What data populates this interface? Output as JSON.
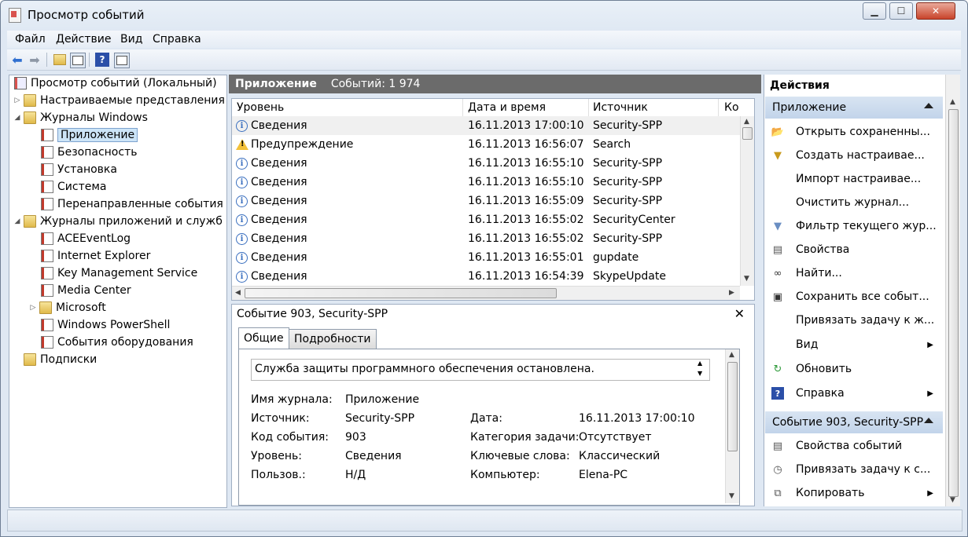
{
  "window": {
    "title": "Просмотр событий",
    "min_icon": "minimize-icon",
    "max_icon": "maximize-icon",
    "close_icon": "close-icon"
  },
  "menu": [
    "Файл",
    "Действие",
    "Вид",
    "Справка"
  ],
  "toolbar": [
    "back-arrow-icon",
    "forward-arrow-icon",
    "up-folder-icon",
    "show-hide-tree-icon",
    "help-icon",
    "show-hide-actions-icon"
  ],
  "tree": {
    "root": "Просмотр событий (Локальный)",
    "custom_views": "Настраиваемые представления",
    "windows_logs": "Журналы Windows",
    "windows_logs_items": [
      "Приложение",
      "Безопасность",
      "Установка",
      "Система",
      "Перенаправленные события"
    ],
    "app_services_logs": "Журналы приложений и служб",
    "app_services_items": [
      "ACEEventLog",
      "Internet Explorer",
      "Key Management Service",
      "Media Center",
      "Microsoft",
      "Windows PowerShell",
      "События оборудования"
    ],
    "subscriptions": "Подписки"
  },
  "log_header": {
    "name": "Приложение",
    "count": "Событий: 1 974"
  },
  "events_table": {
    "columns": [
      "Уровень",
      "Дата и время",
      "Источник",
      "Ко"
    ],
    "rows": [
      {
        "level": "Сведения",
        "type": "info",
        "date": "16.11.2013 17:00:10",
        "source": "Security-SPP"
      },
      {
        "level": "Предупреждение",
        "type": "warning",
        "date": "16.11.2013 16:56:07",
        "source": "Search"
      },
      {
        "level": "Сведения",
        "type": "info",
        "date": "16.11.2013 16:55:10",
        "source": "Security-SPP"
      },
      {
        "level": "Сведения",
        "type": "info",
        "date": "16.11.2013 16:55:10",
        "source": "Security-SPP"
      },
      {
        "level": "Сведения",
        "type": "info",
        "date": "16.11.2013 16:55:09",
        "source": "Security-SPP"
      },
      {
        "level": "Сведения",
        "type": "info",
        "date": "16.11.2013 16:55:02",
        "source": "SecurityCenter"
      },
      {
        "level": "Сведения",
        "type": "info",
        "date": "16.11.2013 16:55:02",
        "source": "Security-SPP"
      },
      {
        "level": "Сведения",
        "type": "info",
        "date": "16.11.2013 16:55:01",
        "source": "gupdate"
      },
      {
        "level": "Сведения",
        "type": "info",
        "date": "16.11.2013 16:54:39",
        "source": "SkypeUpdate"
      }
    ]
  },
  "detail": {
    "title": "Событие 903, Security-SPP",
    "tabs": [
      "Общие",
      "Подробности"
    ],
    "message": "Служба защиты программного обеспечения остановлена.",
    "labels": {
      "journal": "Имя журнала:",
      "source": "Источник:",
      "event_id": "Код события:",
      "level": "Уровень:",
      "user": "Пользов.:",
      "date": "Дата:",
      "task_category": "Категория задачи:",
      "keywords": "Ключевые слова:",
      "computer": "Компьютер:"
    },
    "values": {
      "journal": "Приложение",
      "source": "Security-SPP",
      "event_id": "903",
      "level": "Сведения",
      "user": "Н/Д",
      "date": "16.11.2013 17:00:10",
      "task_category": "Отсутствует",
      "keywords": "Классический",
      "computer": "Elena-PC"
    }
  },
  "actions": {
    "title": "Действия",
    "section1": "Приложение",
    "section1_items": [
      {
        "label": "Открыть сохраненны...",
        "icon": "open-folder-icon"
      },
      {
        "label": "Создать настраивае...",
        "icon": "filter-create-icon"
      },
      {
        "label": "Импорт настраивае...",
        "icon": ""
      },
      {
        "label": "Очистить журнал...",
        "icon": ""
      },
      {
        "label": "Фильтр текущего жур...",
        "icon": "filter-icon"
      },
      {
        "label": "Свойства",
        "icon": "properties-icon"
      },
      {
        "label": "Найти...",
        "icon": "binoculars-icon"
      },
      {
        "label": "Сохранить все событ...",
        "icon": "save-icon"
      },
      {
        "label": "Привязать задачу к ж...",
        "icon": ""
      },
      {
        "label": "Вид",
        "icon": "",
        "submenu": true
      },
      {
        "label": "Обновить",
        "icon": "refresh-icon"
      },
      {
        "label": "Справка",
        "icon": "help-icon",
        "submenu": true
      }
    ],
    "section2": "Событие 903, Security-SPP",
    "section2_items": [
      {
        "label": "Свойства событий",
        "icon": "properties-icon"
      },
      {
        "label": "Привязать задачу к с...",
        "icon": "task-icon"
      },
      {
        "label": "Копировать",
        "icon": "copy-icon",
        "submenu": true
      }
    ]
  },
  "colors": {
    "header_band": "#6b6b6b",
    "section_band": "#c9d9ec",
    "selection": "#cce4f7"
  }
}
